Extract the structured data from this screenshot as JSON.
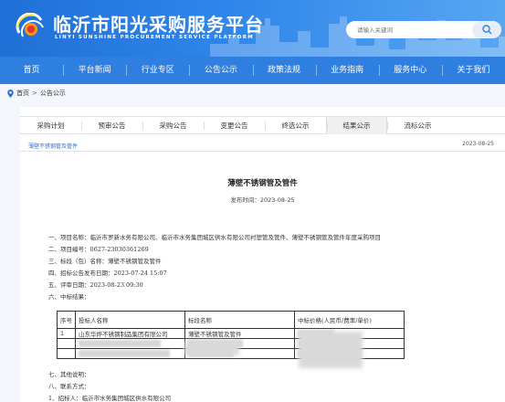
{
  "header": {
    "title_cn": "临沂市阳光采购服务平台",
    "title_en": "LINYI SUNSHINE PROCUREMENT SERVICE PLATFORM",
    "search_placeholder": "请输入关键词"
  },
  "nav": {
    "items": [
      "首页",
      "平台新闻",
      "行业专区",
      "公告公示",
      "政策法规",
      "业务指南",
      "服务中心",
      "关于我们"
    ]
  },
  "breadcrumb": {
    "home": "首页",
    "separator": ">",
    "current": "公告公示"
  },
  "tabs": {
    "items": [
      "采购计划",
      "预审公告",
      "采购公告",
      "变更公告",
      "终选公示",
      "结果公示",
      "流标公示"
    ],
    "active_index": 5
  },
  "list": {
    "sub_title": "薄壁不锈钢管及管件",
    "date": "2023-08-25"
  },
  "article": {
    "title": "薄壁不锈钢管及管件",
    "publish_label": "发布时间：",
    "publish_date": "2023-08-25",
    "lines": [
      "一、项目名称：临沂市罗新水务有限公司、临沂市水务集团城区供水有限公司衬塑管及管件、薄壁不锈钢管及管件年度采购项目",
      "二、项目编号：0627-23030361269",
      "三、标段（包）名称：薄壁不锈钢管及管件",
      "四、招标公告发布日期：2023-07-24 15:07",
      "五、评审日期：2023-08-23 09:30",
      "六、中标结果："
    ],
    "lines_after": [
      "七、其他说明：",
      "八、联系方式：",
      "1、招标人：临沂市水务集团城区供水有限公司"
    ]
  },
  "result_table": {
    "headers": [
      "序号",
      "投标人名称",
      "标段名称",
      "中标价格(人民币/费率/单价)"
    ],
    "rows": [
      {
        "no": "1",
        "bidder": "山东华烨不锈钢制品集团有限公司",
        "section": "薄壁不锈钢管及管件",
        "price": ""
      },
      {
        "no": "",
        "bidder": "",
        "section": "",
        "price": ""
      },
      {
        "no": "",
        "bidder": "",
        "section": "",
        "price": ""
      }
    ]
  },
  "colors": {
    "header_blue": "#1f6fd6",
    "nav_blue": "#2f7fe0",
    "link_blue": "#2f6fc8"
  },
  "icons": {
    "logo": "sun-logo-icon",
    "search": "search-icon",
    "location": "location-pin-icon"
  }
}
